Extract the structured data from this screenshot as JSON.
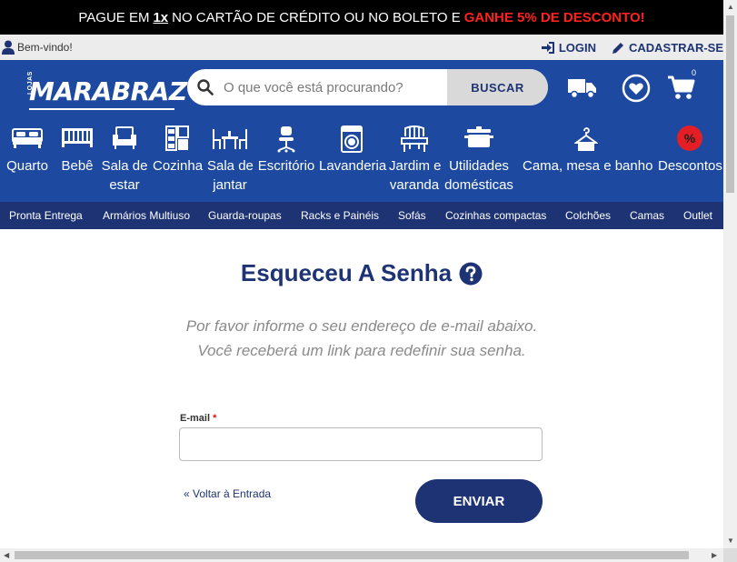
{
  "promo": {
    "part1": "PAGUE EM",
    "highlight": "1x",
    "part2": "NO CARTÃO DE CRÉDITO OU NO BOLETO E",
    "red": "GANHE 5% DE DESCONTO!"
  },
  "topbar": {
    "welcome": "Bem-vindo!",
    "login": "LOGIN",
    "register": "CADASTRAR-SE"
  },
  "header": {
    "logo_small": "LOJAS",
    "logo": "MARABRAZ",
    "search_placeholder": "O que você está procurando?",
    "search_button": "BUSCAR",
    "cart_count": "0"
  },
  "categories": [
    {
      "line1": "Quarto",
      "line2": "",
      "icon": "bed-icon"
    },
    {
      "line1": "Bebê",
      "line2": "",
      "icon": "crib-icon"
    },
    {
      "line1": "Sala de",
      "line2": "estar",
      "icon": "armchair-icon"
    },
    {
      "line1": "Cozinha",
      "line2": "",
      "icon": "kitchen-cabinet-icon"
    },
    {
      "line1": "Sala de",
      "line2": "jantar",
      "icon": "dining-table-icon"
    },
    {
      "line1": "Escritório",
      "line2": "",
      "icon": "office-chair-icon"
    },
    {
      "line1": "Lavanderia",
      "line2": "",
      "icon": "washing-machine-icon"
    },
    {
      "line1": "Jardim e",
      "line2": "varanda",
      "icon": "garden-bench-icon"
    },
    {
      "line1": "Utilidades",
      "line2": "domésticas",
      "icon": "pot-icon"
    },
    {
      "line1": "Cama, mesa e banho",
      "line2": "",
      "icon": "hanger-icon"
    },
    {
      "line1": "Descontos",
      "line2": "",
      "icon": "discount-icon",
      "icon_text": "%"
    }
  ],
  "subnav": [
    "Pronta Entrega",
    "Armários Multiuso",
    "Guarda-roupas",
    "Racks e Painéis",
    "Sofás",
    "Cozinhas compactas",
    "Colchões",
    "Camas",
    "Outlet"
  ],
  "form": {
    "title": "Esqueceu A Senha",
    "description": "Por favor informe o seu endereço de e-mail abaixo. Você receberá um link para redefinir sua senha.",
    "email_label": "E-mail",
    "required_mark": "*",
    "email_value": "",
    "back_link": "« Voltar à Entrada",
    "submit": "ENVIAR"
  },
  "colors": {
    "brand_blue": "#1d4aa0",
    "dark_blue": "#1d3374",
    "promo_red": "#ff2020",
    "discount_red": "#e31e24"
  }
}
